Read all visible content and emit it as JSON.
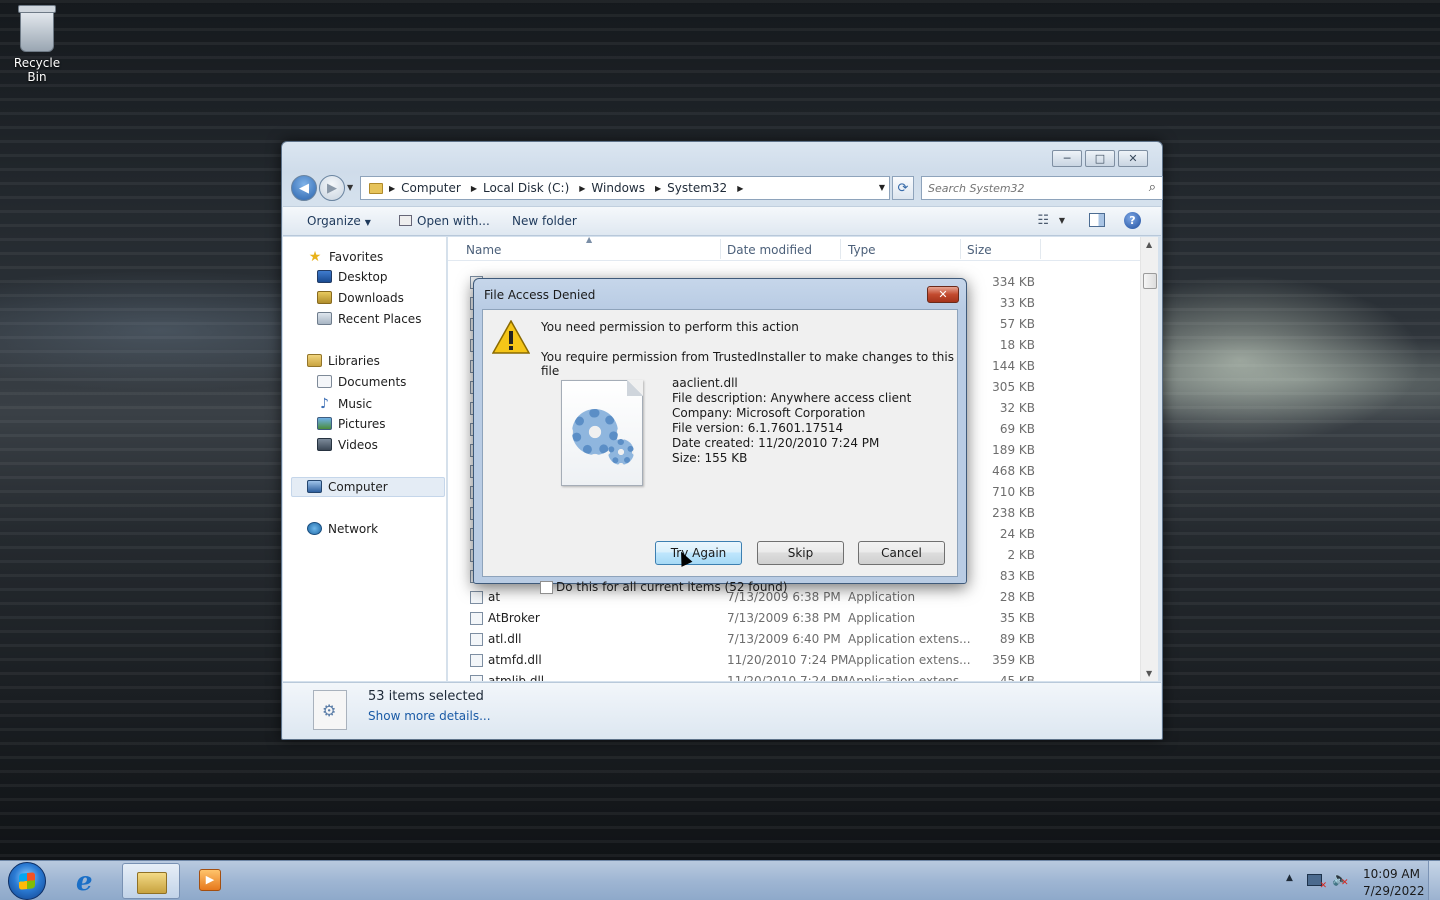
{
  "desktop": {
    "icons": [
      {
        "label": "Recycle Bin",
        "icon": "recycle-bin-icon"
      }
    ]
  },
  "explorer": {
    "caption_buttons": {
      "minimize": "─",
      "maximize": "□",
      "close": "✕"
    },
    "address": {
      "crumbs": [
        "Computer",
        "Local Disk (C:)",
        "Windows",
        "System32"
      ]
    },
    "search": {
      "placeholder": "Search System32"
    },
    "toolbar": {
      "organize": "Organize",
      "open_with": "Open with...",
      "new_folder": "New folder"
    },
    "nav_pane": {
      "favorites": "Favorites",
      "desktop": "Desktop",
      "downloads": "Downloads",
      "recent_places": "Recent Places",
      "libraries": "Libraries",
      "documents": "Documents",
      "music": "Music",
      "pictures": "Pictures",
      "videos": "Videos",
      "computer": "Computer",
      "network": "Network"
    },
    "columns": {
      "name": "Name",
      "date": "Date modified",
      "type": "Type",
      "size": "Size"
    },
    "rows": [
      {
        "name": "",
        "date": "",
        "type": "",
        "size": "334 KB"
      },
      {
        "name": "",
        "date": "",
        "type": "",
        "size": "33 KB"
      },
      {
        "name": "",
        "date": "",
        "type": "",
        "size": "57 KB"
      },
      {
        "name": "",
        "date": "",
        "type": "",
        "size": "18 KB"
      },
      {
        "name": "",
        "date": "",
        "type": "",
        "size": "144 KB"
      },
      {
        "name": "",
        "date": "",
        "type": "",
        "size": "305 KB"
      },
      {
        "name": "",
        "date": "",
        "type": "",
        "size": "32 KB"
      },
      {
        "name": "",
        "date": "",
        "type": "",
        "size": "69 KB"
      },
      {
        "name": "",
        "date": "",
        "type": "",
        "size": "189 KB"
      },
      {
        "name": "",
        "date": "",
        "type": "",
        "size": "468 KB"
      },
      {
        "name": "",
        "date": "",
        "type": "",
        "size": "710 KB"
      },
      {
        "name": "",
        "date": "",
        "type": "",
        "size": "238 KB"
      },
      {
        "name": "",
        "date": "",
        "type": "",
        "size": "24 KB"
      },
      {
        "name": "",
        "date": "",
        "type": "",
        "size": "2 KB"
      },
      {
        "name": "",
        "date": "",
        "type": "",
        "size": "83 KB"
      },
      {
        "name": "at",
        "date": "7/13/2009 6:38 PM",
        "type": "Application",
        "size": "28 KB"
      },
      {
        "name": "AtBroker",
        "date": "7/13/2009 6:38 PM",
        "type": "Application",
        "size": "35 KB"
      },
      {
        "name": "atl.dll",
        "date": "7/13/2009 6:40 PM",
        "type": "Application extens...",
        "size": "89 KB"
      },
      {
        "name": "atmfd.dll",
        "date": "11/20/2010 7:24 PM",
        "type": "Application extens...",
        "size": "359 KB"
      },
      {
        "name": "atmlib.dll",
        "date": "11/20/2010 7:24 PM",
        "type": "Application extens...",
        "size": "45 KB"
      }
    ],
    "details": {
      "count": "53 items selected",
      "more": "Show more details..."
    }
  },
  "dialog": {
    "title": "File Access Denied",
    "close": "✕",
    "heading": "You need permission to perform this action",
    "subheading": "You require permission from TrustedInstaller to make changes to this file",
    "file": {
      "name": "aaclient.dll",
      "description": "File description: Anywhere access client",
      "company": "Company: Microsoft Corporation",
      "version": "File version: 6.1.7601.17514",
      "created": "Date created: 11/20/2010 7:24 PM",
      "size": "Size: 155 KB"
    },
    "buttons": {
      "try_again": "Try Again",
      "skip": "Skip",
      "cancel": "Cancel"
    },
    "checkbox_label": "Do this for all current items (52 found)"
  },
  "taskbar": {
    "time": "10:09 AM",
    "date": "7/29/2022"
  }
}
